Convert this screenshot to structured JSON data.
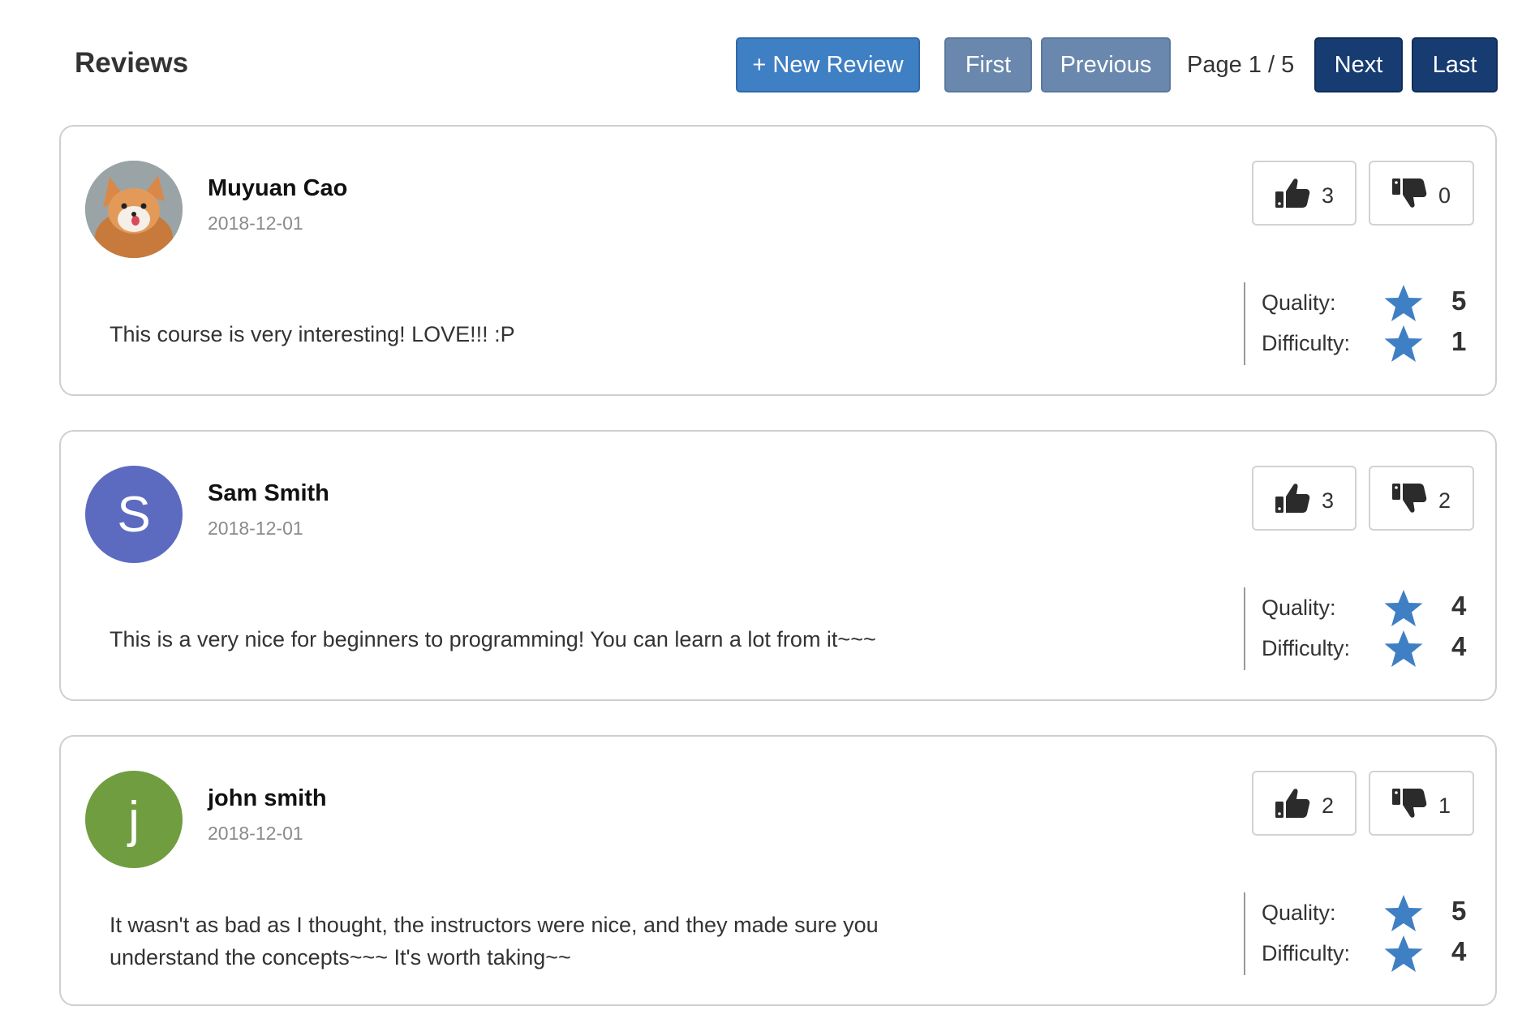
{
  "header": {
    "title": "Reviews"
  },
  "toolbar": {
    "new_review_label": "+ New Review",
    "first_label": "First",
    "previous_label": "Previous",
    "page_indicator": "Page 1 / 5",
    "next_label": "Next",
    "last_label": "Last"
  },
  "labels": {
    "quality": "Quality:",
    "difficulty": "Difficulty:"
  },
  "colors": {
    "primary": "#3f7fc4",
    "nav_disabled": "#6a88ad",
    "nav_dark": "#173c72",
    "star": "#3f7fc4",
    "avatar_s": "#5c6bc0",
    "avatar_j": "#6f9d40"
  },
  "reviews": [
    {
      "author": "Muyuan Cao",
      "date": "2018-12-01",
      "avatar": "fox-photo",
      "text": "This course is very interesting! LOVE!!! :P",
      "thumbs_up": "3",
      "thumbs_down": "0",
      "quality": "5",
      "difficulty": "1"
    },
    {
      "author": "Sam Smith",
      "date": "2018-12-01",
      "avatar_initial": "S",
      "text": "This is a very nice for beginners to programming! You can learn a lot from it~~~",
      "thumbs_up": "3",
      "thumbs_down": "2",
      "quality": "4",
      "difficulty": "4"
    },
    {
      "author": "john smith",
      "date": "2018-12-01",
      "avatar_initial": "j",
      "text": "It wasn't as bad as I thought, the instructors were nice, and they made sure you understand the concepts~~~ It's worth taking~~",
      "thumbs_up": "2",
      "thumbs_down": "1",
      "quality": "5",
      "difficulty": "4"
    }
  ]
}
